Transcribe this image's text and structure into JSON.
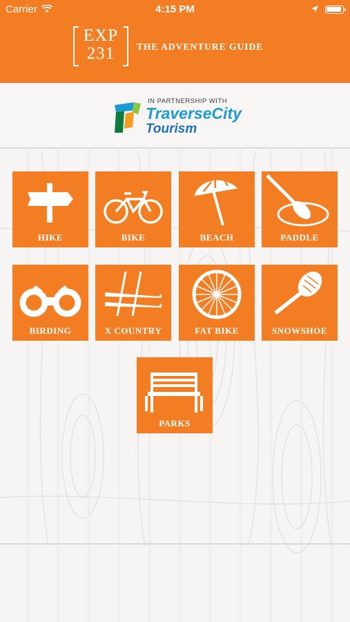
{
  "status_bar": {
    "carrier": "Carrier",
    "time": "4:15 PM"
  },
  "header": {
    "logo_line1": "EXP",
    "logo_line2": "231",
    "tagline": "THE ADVENTURE GUIDE",
    "background_color": "#f27d23"
  },
  "partner": {
    "intro": "IN PARTNERSHIP WITH",
    "name_line1": "TraverseCity",
    "name_line2": "Tourism"
  },
  "tiles": [
    {
      "label": "HIKE",
      "icon": "signpost-icon"
    },
    {
      "label": "BIKE",
      "icon": "bicycle-icon"
    },
    {
      "label": "BEACH",
      "icon": "umbrella-icon"
    },
    {
      "label": "PADDLE",
      "icon": "paddle-icon"
    },
    {
      "label": "BIRDING",
      "icon": "binoculars-icon"
    },
    {
      "label": "X COUNTRY",
      "icon": "skis-icon"
    },
    {
      "label": "FAT BIKE",
      "icon": "wheel-icon"
    },
    {
      "label": "SNOWSHOE",
      "icon": "snowshoe-icon"
    },
    {
      "label": "PARKS",
      "icon": "bench-icon"
    }
  ]
}
